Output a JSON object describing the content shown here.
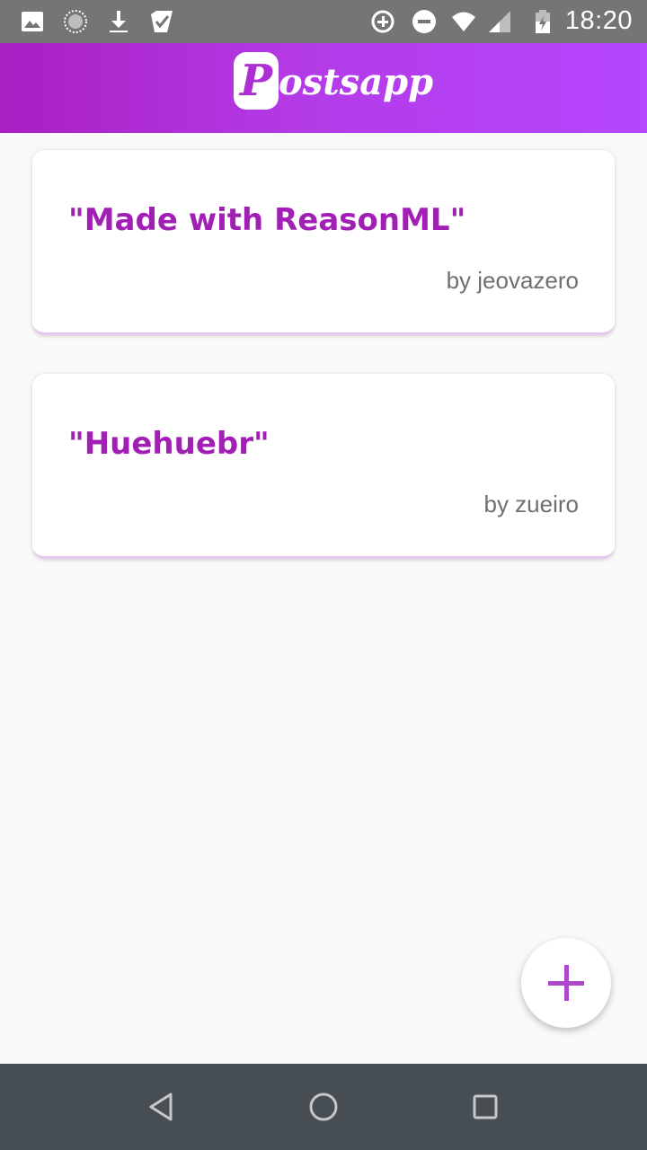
{
  "status_bar": {
    "time": "18:20",
    "left_icons": [
      "image-icon",
      "loading-icon",
      "download-icon",
      "check-app-icon"
    ],
    "right_icons": [
      "data-saver-icon",
      "do-not-disturb-icon",
      "wifi-icon",
      "cellular-signal-icon",
      "battery-icon"
    ]
  },
  "header": {
    "logo_initial": "P",
    "logo_rest": "ostsapp",
    "gradient_start": "#a91fc2",
    "gradient_end": "#b647ff"
  },
  "posts": [
    {
      "title": "\"Made with ReasonML\"",
      "author": "by jeovazero"
    },
    {
      "title": "\"Huehuebr\"",
      "author": "by zueiro"
    }
  ],
  "fab": {
    "icon": "plus-icon",
    "color": "#ad47cc"
  },
  "nav_bar": {
    "buttons": [
      "back-icon",
      "home-icon",
      "recents-icon"
    ]
  },
  "colors": {
    "title": "#a21fb5",
    "author": "#6f6f6f",
    "card_accent": "#e6c7ef"
  }
}
